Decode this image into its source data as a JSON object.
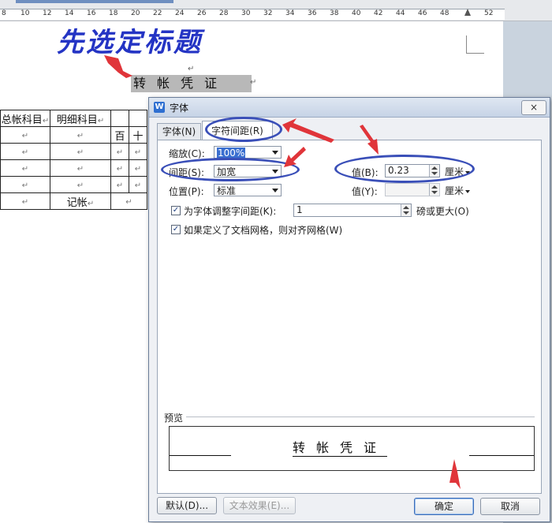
{
  "ruler": {
    "ticks": [
      "8",
      "10",
      "12",
      "14",
      "16",
      "18",
      "20",
      "22",
      "24",
      "26",
      "28",
      "30",
      "32",
      "34",
      "36",
      "38",
      "40",
      "42",
      "44",
      "46",
      "48",
      "52"
    ]
  },
  "document": {
    "big_title": "先选定标题",
    "para_mark": "↵",
    "doc_title": "转帐凭证",
    "table": {
      "header_1": "总帐科目",
      "header_2": "明细科目",
      "col_bai": "百",
      "col_shi": "十",
      "footer_label": "记帐"
    }
  },
  "dialog": {
    "app_icon": "W",
    "title": "字体",
    "close": "×",
    "tabs": [
      "字体(N)",
      "字符间距(R)"
    ],
    "scale": {
      "label": "缩放(C):",
      "value": "100%"
    },
    "spacing": {
      "label": "间距(S):",
      "value": "加宽",
      "value_label": "值(B):",
      "number": "0.23",
      "unit": "厘米"
    },
    "position": {
      "label": "位置(P):",
      "value": "标准",
      "value_label": "值(Y):",
      "number": "",
      "unit": "厘米"
    },
    "kerning": {
      "label": "为字体调整字间距(K):",
      "value": "1",
      "suffix": "磅或更大(O)",
      "checked": true
    },
    "snap_grid": {
      "label": "如果定义了文档网格，则对齐网格(W)",
      "checked": true
    },
    "preview": {
      "label": "预览",
      "sample": "转帐凭证"
    },
    "buttons": {
      "default": "默认(D)...",
      "text_effects": "文本效果(E)...",
      "ok": "确定",
      "cancel": "取消"
    }
  },
  "colors": {
    "annotation_red": "#e0353a",
    "annotation_blue": "#3a4fb8",
    "title_blue": "#2434c4"
  }
}
